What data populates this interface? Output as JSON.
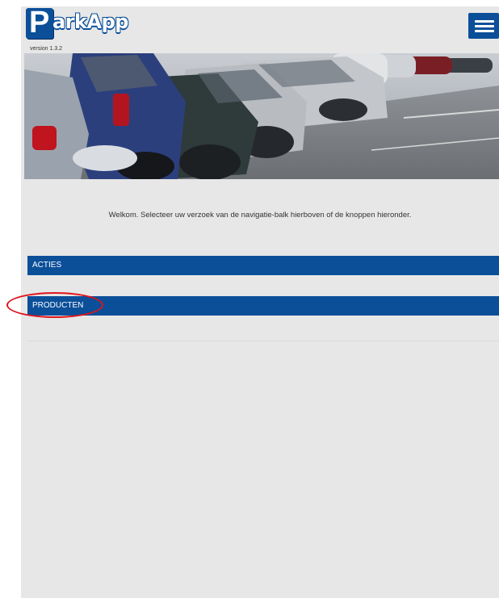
{
  "header": {
    "logo_letter": "P",
    "logo_text": "arkApp",
    "version": "version 1.3.2",
    "menu_icon": "hamburger-menu-icon"
  },
  "hero": {
    "image": "parking-lot-cars-photo"
  },
  "main": {
    "welcome_text": "Welkom. Selecteer uw verzoek van de navigatie-balk hierboven of de knoppen hieronder."
  },
  "nav": {
    "acties_label": "ACTIES",
    "producten_label": "PRODUCTEN"
  },
  "colors": {
    "brand_blue": "#0b4f99",
    "background": "#e7e7e7",
    "highlight_red": "#e0141b"
  }
}
